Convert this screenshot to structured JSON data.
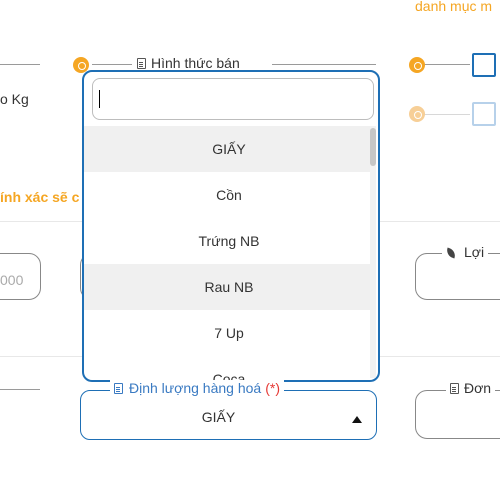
{
  "top_right_text": "danh mục m",
  "left_unit_text": "o Kg",
  "warning_text": "ính xác sẽ c",
  "left_input_value": "000",
  "hinh_thuc_ban": {
    "label": "Hình thức bán"
  },
  "dropdown": {
    "search_value": "",
    "items": [
      {
        "label": "GIẤY",
        "highlighted": true
      },
      {
        "label": "Cồn",
        "highlighted": false
      },
      {
        "label": "Trứng NB",
        "highlighted": false
      },
      {
        "label": "Rau NB",
        "highlighted": true
      },
      {
        "label": "7 Up",
        "highlighted": false
      },
      {
        "label": "Coca",
        "highlighted": false
      }
    ]
  },
  "loi_label": "Lợi",
  "dinh_luong": {
    "label": "Định lượng hàng hoá",
    "required_mark": "(*)",
    "value": "GIẤY"
  },
  "don_label": "Đơn",
  "colors": {
    "accent_blue": "#1e6fb5",
    "orange": "#f5a623",
    "required_red": "#e53935"
  }
}
